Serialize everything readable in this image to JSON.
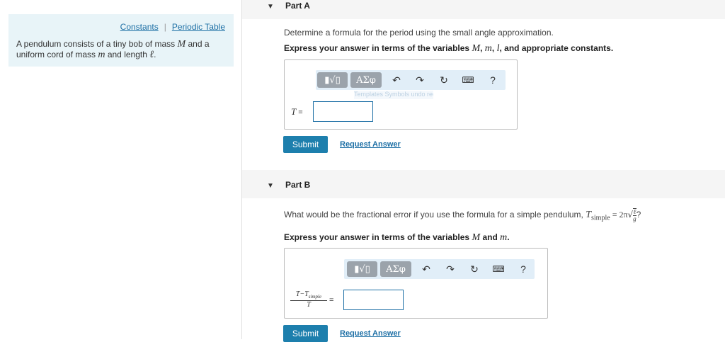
{
  "sidebar": {
    "constants_link": "Constants",
    "separator": "|",
    "periodic_table_link": "Periodic Table",
    "problem_text_parts": [
      "A pendulum consists of a tiny bob of mass ",
      "M",
      " and a uniform cord of mass ",
      "m",
      " and length ",
      "ℓ",
      "."
    ]
  },
  "part_a": {
    "title": "Part A",
    "question": "Determine a formula for the period using the small angle approximation.",
    "instruction_prefix": "Express your answer in terms of the variables ",
    "var_1": "M",
    "var_2": "m",
    "var_3": "l",
    "instruction_suffix": ", and appropriate constants.",
    "sep_comma": ", ",
    "sep_and": ", and ",
    "input_label": "T",
    "input_eq": " =",
    "input_value": "",
    "tooltip_ghost": "Templates Symbols undo redo reset keyboard shortcuts help Rectangular Snip",
    "submit_label": "Submit",
    "request_label": "Request Answer"
  },
  "part_b": {
    "title": "Part B",
    "question": "What would be the fractional error if you use the formula for a simple pendulum, ",
    "formula_T": "T",
    "formula_sub": "simple",
    "formula_eq": " = 2π",
    "formula_num": "ℓ",
    "formula_den": "g",
    "question_end": "?",
    "instruction_prefix": "Express your answer in terms of the variables ",
    "var_1": "M",
    "var_and": " and ",
    "var_2": "m",
    "instruction_suffix": ".",
    "frac_num": "T−T",
    "frac_num_sub": "simple",
    "frac_den": "T",
    "input_eq": "=",
    "input_value": "",
    "submit_label": "Submit",
    "request_label": "Request Answer"
  },
  "toolbar": {
    "templates_glyph": "▮√▯",
    "symbols_label": "ΑΣφ",
    "undo_glyph": "↶",
    "redo_glyph": "↷",
    "reset_glyph": "↻",
    "keyboard_glyph": "⌨",
    "help_glyph": "?"
  },
  "icons": {
    "part_caret": "chevron-down-icon",
    "templates": "templates-icon",
    "symbols": "greek-symbols-icon",
    "undo": "undo-icon",
    "redo": "redo-icon",
    "reset": "reset-icon",
    "keyboard": "keyboard-icon",
    "help": "help-icon"
  },
  "colors": {
    "accent": "#1d7fad",
    "link": "#1d6fa5",
    "sidebar_bg": "#e8f4f8",
    "toolbar_bg": "#e1eef8"
  }
}
